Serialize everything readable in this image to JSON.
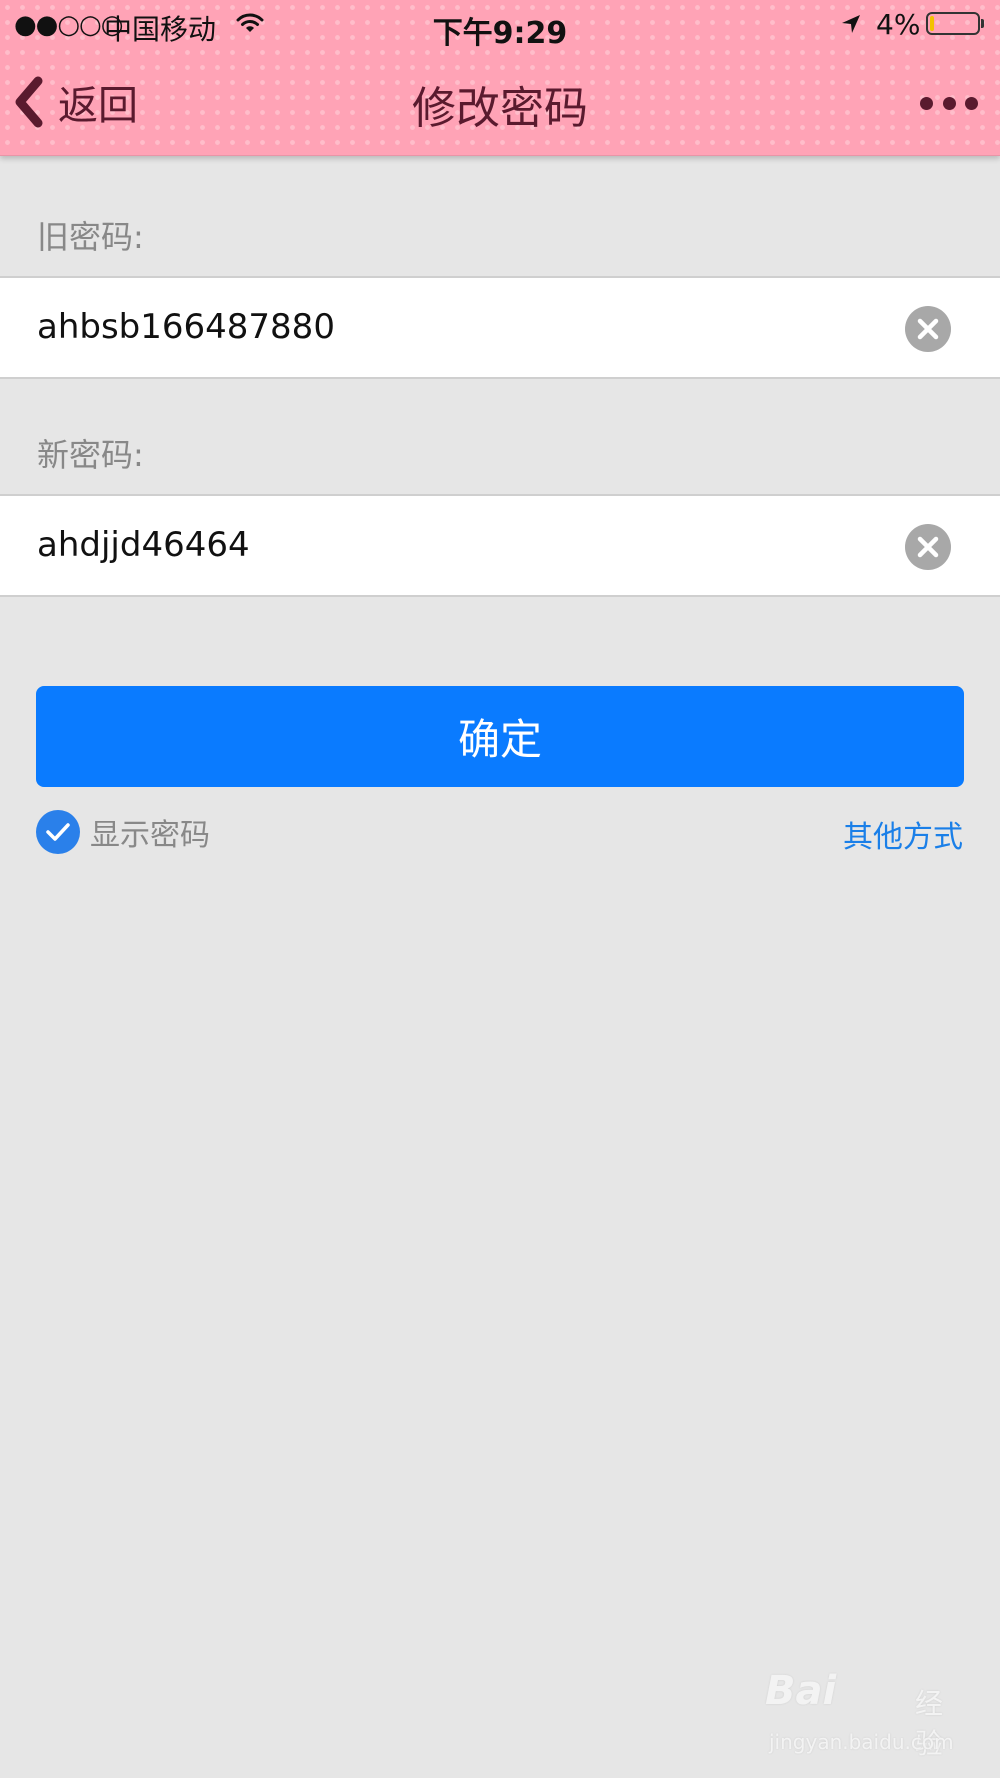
{
  "status_bar": {
    "signal": "●●○○○",
    "carrier": "中国移动",
    "time": "下午9:29",
    "battery_percent": "4%",
    "icons": [
      "wifi-icon",
      "location-icon",
      "battery-icon"
    ]
  },
  "nav": {
    "back_label": "返回",
    "title": "修改密码",
    "back_icon": "chevron-left-icon",
    "more_icon": "more-dots-icon"
  },
  "form": {
    "old_password_label": "旧密码:",
    "old_password_value": "ahbsb166487880",
    "new_password_label": "新密码:",
    "new_password_value": "ahdjjd46464",
    "clear_icon": "clear-icon"
  },
  "actions": {
    "confirm_label": "确定",
    "show_password_label": "显示密码",
    "show_password_checked": true,
    "other_methods_label": "其他方式"
  },
  "watermark": {
    "brand": "Bai",
    "brand_cn": "经验",
    "url": "jingyan.baidu.com"
  },
  "colors": {
    "header_bg": "#ffa3b6",
    "header_text": "#5a1a2e",
    "page_bg": "#e6e6e6",
    "primary_button": "#0a7bff",
    "link": "#1a7fe8",
    "checkbox": "#2a80ea"
  }
}
